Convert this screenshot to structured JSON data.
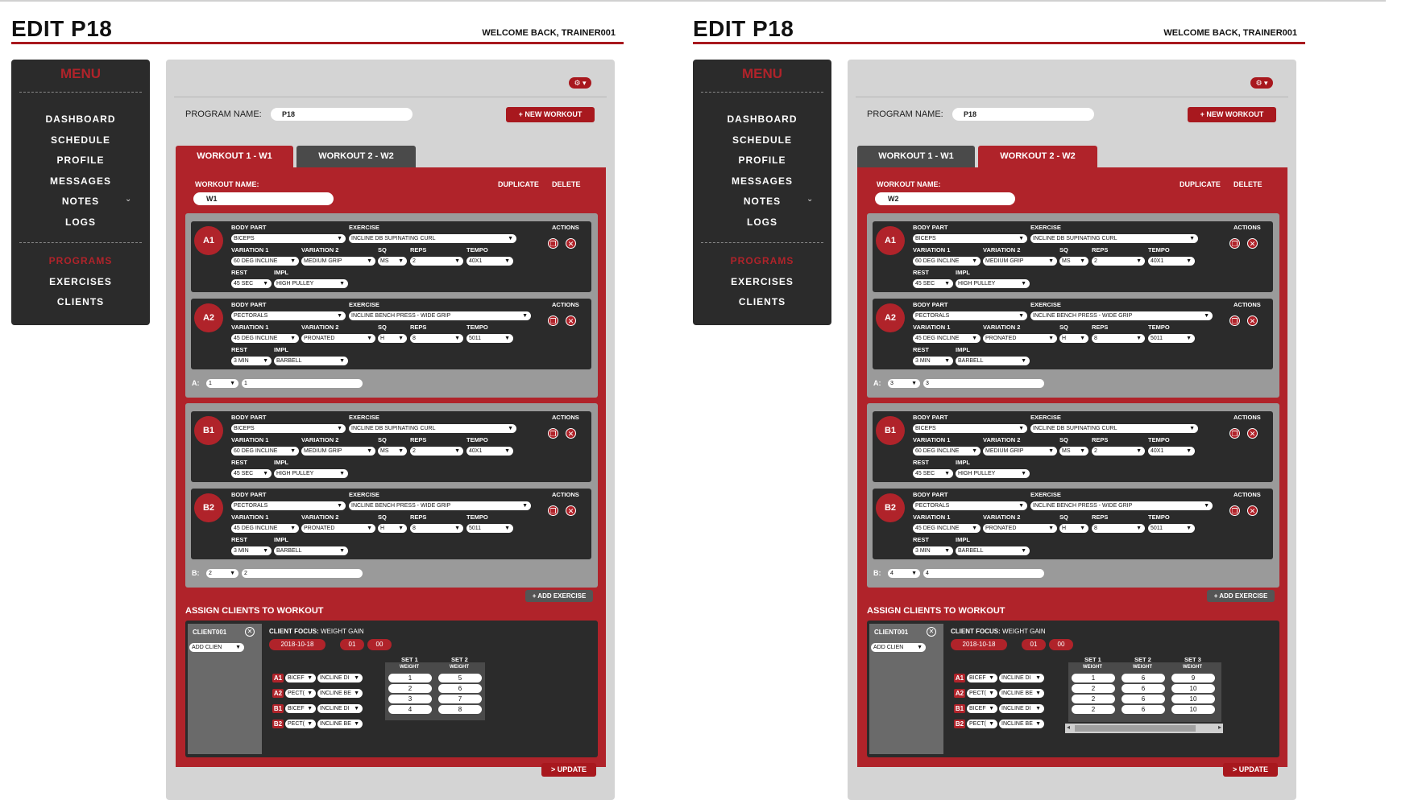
{
  "frames": [
    {
      "title": "EDIT P18",
      "welcome": "WELCOME BACK, TRAINER001",
      "menu": {
        "title": "MENU",
        "items": [
          "DASHBOARD",
          "SCHEDULE",
          "PROFILE",
          "MESSAGES",
          "NOTES",
          "LOGS"
        ],
        "items2": [
          "PROGRAMS",
          "EXERCISES",
          "CLIENTS"
        ],
        "active": "PROGRAMS"
      },
      "program_label": "PROGRAM NAME:",
      "program_name": "P18",
      "new_workout": "+ NEW WORKOUT",
      "tabs": [
        {
          "label": "WORKOUT 1 - W1",
          "active": true
        },
        {
          "label": "WORKOUT 2 - W2",
          "active": false
        }
      ],
      "workout_label": "WORKOUT NAME:",
      "workout_name": "W1",
      "duplicate": "DUPLICATE",
      "delete": "DELETE",
      "groups": [
        {
          "label": "A:",
          "sel": "1",
          "input": "1",
          "exercises": [
            {
              "badge": "A1",
              "body_part": "BICEPS",
              "exercise": "INCLINE DB SUPINATING CURL",
              "var1": "60 DEG INCLINE",
              "var2": "MEDIUM GRIP",
              "sq": "MS",
              "reps": "2",
              "tempo": "40X1",
              "rest": "45 SEC",
              "impl": "HIGH PULLEY"
            },
            {
              "badge": "A2",
              "body_part": "PECTORALS",
              "exercise": "INCLINE BENCH PRESS - WIDE GRIP",
              "var1": "45 DEG INCLINE",
              "var2": "PRONATED",
              "sq": "H",
              "reps": "8",
              "tempo": "5011",
              "rest": "3 MIN",
              "impl": "BARBELL"
            }
          ]
        },
        {
          "label": "B:",
          "sel": "2",
          "input": "2",
          "exercises": [
            {
              "badge": "B1",
              "body_part": "BICEPS",
              "exercise": "INCLINE DB SUPINATING CURL",
              "var1": "60 DEG INCLINE",
              "var2": "MEDIUM GRIP",
              "sq": "MS",
              "reps": "2",
              "tempo": "40X1",
              "rest": "45 SEC",
              "impl": "HIGH PULLEY"
            },
            {
              "badge": "B2",
              "body_part": "PECTORALS",
              "exercise": "INCLINE BENCH PRESS - WIDE GRIP",
              "var1": "45 DEG INCLINE",
              "var2": "PRONATED",
              "sq": "H",
              "reps": "8",
              "tempo": "5011",
              "rest": "3 MIN",
              "impl": "BARBELL"
            }
          ]
        }
      ],
      "labels": {
        "body_part": "BODY PART",
        "exercise": "EXERCISE",
        "actions": "ACTIONS",
        "var1": "VARIATION 1",
        "var2": "VARIATION 2",
        "sq": "SQ",
        "reps": "REPS",
        "tempo": "TEMPO",
        "rest": "REST",
        "impl": "IMPL"
      },
      "add_exercise": "+ ADD EXERCISE",
      "assign_title": "ASSIGN CLIENTS TO WORKOUT",
      "client": "CLIENT001",
      "add_client": "ADD CLIEN",
      "client_focus_label": "CLIENT FOCUS:",
      "client_focus": "WEIGHT GAIN",
      "date": "2018-10-18",
      "hour": "01",
      "minute": "00",
      "rows": [
        {
          "badge": "A1",
          "a": "BICEF",
          "b": "INCLINE DI"
        },
        {
          "badge": "A2",
          "a": "PECT(",
          "b": "INCLINE BE"
        },
        {
          "badge": "B1",
          "a": "BICEF",
          "b": "INCLINE DI"
        },
        {
          "badge": "B2",
          "a": "PECT(",
          "b": "INCLINE BE"
        }
      ],
      "sets": [
        {
          "label": "SET 1",
          "sub": "WEIGHT",
          "values": [
            "1",
            "2",
            "3",
            "4"
          ]
        },
        {
          "label": "SET 2",
          "sub": "WEIGHT",
          "values": [
            "5",
            "6",
            "7",
            "8"
          ]
        }
      ],
      "update": "> UPDATE"
    },
    {
      "title": "EDIT P18",
      "welcome": "WELCOME BACK, TRAINER001",
      "menu": {
        "title": "MENU",
        "items": [
          "DASHBOARD",
          "SCHEDULE",
          "PROFILE",
          "MESSAGES",
          "NOTES",
          "LOGS"
        ],
        "items2": [
          "PROGRAMS",
          "EXERCISES",
          "CLIENTS"
        ],
        "active": "PROGRAMS"
      },
      "program_label": "PROGRAM NAME:",
      "program_name": "P18",
      "new_workout": "+ NEW WORKOUT",
      "tabs": [
        {
          "label": "WORKOUT 1 - W1",
          "active": false
        },
        {
          "label": "WORKOUT 2 - W2",
          "active": true
        }
      ],
      "workout_label": "WORKOUT NAME:",
      "workout_name": "W2",
      "duplicate": "DUPLICATE",
      "delete": "DELETE",
      "groups": [
        {
          "label": "A:",
          "sel": "3",
          "input": "3",
          "exercises": [
            {
              "badge": "A1",
              "body_part": "BICEPS",
              "exercise": "INCLINE DB SUPINATING CURL",
              "var1": "60 DEG INCLINE",
              "var2": "MEDIUM GRIP",
              "sq": "MS",
              "reps": "2",
              "tempo": "40X1",
              "rest": "45 SEC",
              "impl": "HIGH PULLEY"
            },
            {
              "badge": "A2",
              "body_part": "PECTORALS",
              "exercise": "INCLINE BENCH PRESS - WIDE GRIP",
              "var1": "45 DEG INCLINE",
              "var2": "PRONATED",
              "sq": "H",
              "reps": "8",
              "tempo": "5011",
              "rest": "3 MIN",
              "impl": "BARBELL"
            }
          ]
        },
        {
          "label": "B:",
          "sel": "4",
          "input": "4",
          "exercises": [
            {
              "badge": "B1",
              "body_part": "BICEPS",
              "exercise": "INCLINE DB SUPINATING CURL",
              "var1": "60 DEG INCLINE",
              "var2": "MEDIUM GRIP",
              "sq": "MS",
              "reps": "2",
              "tempo": "40X1",
              "rest": "45 SEC",
              "impl": "HIGH PULLEY"
            },
            {
              "badge": "B2",
              "body_part": "PECTORALS",
              "exercise": "INCLINE BENCH PRESS - WIDE GRIP",
              "var1": "45 DEG INCLINE",
              "var2": "PRONATED",
              "sq": "H",
              "reps": "8",
              "tempo": "5011",
              "rest": "3 MIN",
              "impl": "BARBELL"
            }
          ]
        }
      ],
      "labels": {
        "body_part": "BODY PART",
        "exercise": "EXERCISE",
        "actions": "ACTIONS",
        "var1": "VARIATION 1",
        "var2": "VARIATION 2",
        "sq": "SQ",
        "reps": "REPS",
        "tempo": "TEMPO",
        "rest": "REST",
        "impl": "IMPL"
      },
      "add_exercise": "+ ADD EXERCISE",
      "assign_title": "ASSIGN CLIENTS TO WORKOUT",
      "client": "CLIENT001",
      "add_client": "ADD CLIEN",
      "client_focus_label": "CLIENT FOCUS:",
      "client_focus": "WEIGHT GAIN",
      "date": "2018-10-18",
      "hour": "01",
      "minute": "00",
      "rows": [
        {
          "badge": "A1",
          "a": "BICEF",
          "b": "INCLINE DI"
        },
        {
          "badge": "A2",
          "a": "PECT(",
          "b": "INCLINE BE"
        },
        {
          "badge": "B1",
          "a": "BICEF",
          "b": "INCLINE DI"
        },
        {
          "badge": "B2",
          "a": "PECT(",
          "b": "INCLINE BE"
        }
      ],
      "sets": [
        {
          "label": "SET 1",
          "sub": "WEIGHT",
          "values": [
            "1",
            "2",
            "2",
            "2"
          ]
        },
        {
          "label": "SET 2",
          "sub": "WEIGHT",
          "values": [
            "6",
            "6",
            "6",
            "6"
          ]
        },
        {
          "label": "SET 3",
          "sub": "WEIGHT",
          "values": [
            "9",
            "10",
            "10",
            "10"
          ]
        }
      ],
      "update": "> UPDATE"
    }
  ]
}
